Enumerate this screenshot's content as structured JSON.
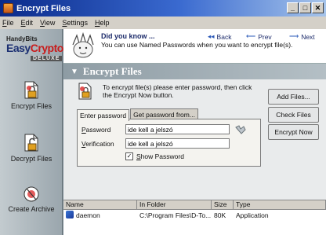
{
  "window": {
    "title": "Encrypt Files"
  },
  "menu": [
    "File",
    "Edit",
    "View",
    "Settings",
    "Help"
  ],
  "brand": {
    "line1": "HandyBits",
    "line2a": "Easy",
    "line2b": "Crypto",
    "line3": "DELUXE"
  },
  "sidebar": {
    "items": [
      {
        "label": "Encrypt Files"
      },
      {
        "label": "Decrypt Files"
      },
      {
        "label": "Create Archive"
      }
    ]
  },
  "tip": {
    "title": "Did you know ...",
    "text": "You can use Named Passwords when you want to encrypt file(s).",
    "back": "Back",
    "prev": "Prev",
    "next": "Next"
  },
  "panel": {
    "title": "Encrypt Files",
    "instruction": "To encrypt file(s) please enter password, then click the Encrypt Now button.",
    "tabs": [
      "Enter password",
      "Get password from..."
    ],
    "password_label": "Password",
    "password_value": "ide kell a jelszó",
    "verification_label": "Verification",
    "verification_value": "ide kell a jelszó",
    "show_password": "Show Password"
  },
  "buttons": {
    "add_files": "Add Files...",
    "check_files": "Check Files",
    "encrypt_now": "Encrypt Now"
  },
  "file_list": {
    "columns": [
      "Name",
      "In Folder",
      "Size",
      "Type"
    ],
    "rows": [
      {
        "name": "daemon",
        "folder": "C:\\Program Files\\D-To...",
        "size": "80K",
        "type": "Application"
      }
    ]
  }
}
